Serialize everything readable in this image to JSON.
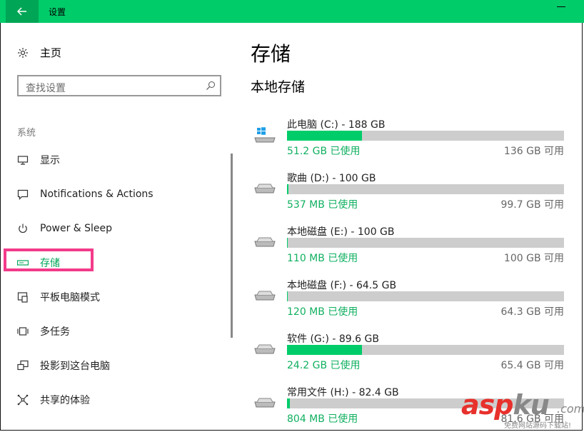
{
  "window": {
    "title": "设置",
    "back_icon": "arrow-left-icon"
  },
  "nav": {
    "home_label": "主页",
    "search_placeholder": "查找设置",
    "group_label": "系统",
    "items": [
      {
        "label": "显示",
        "icon": "monitor-icon"
      },
      {
        "label": "Notifications & Actions",
        "icon": "notification-icon"
      },
      {
        "label": "Power & Sleep",
        "icon": "power-icon"
      },
      {
        "label": "存储",
        "icon": "storage-icon",
        "active": true
      },
      {
        "label": "平板电脑模式",
        "icon": "tablet-mode-icon"
      },
      {
        "label": "多任务",
        "icon": "multitask-icon"
      },
      {
        "label": "投影到这台电脑",
        "icon": "project-icon"
      },
      {
        "label": "共享的体验",
        "icon": "shared-experience-icon"
      }
    ]
  },
  "main": {
    "title": "存储",
    "section": "本地存储",
    "drives": [
      {
        "name": "此电脑 (C:) - 188 GB",
        "used": "51.2 GB 已使用",
        "free": "136 GB 可用",
        "fill": 0.27,
        "icon": "windows-drive-icon"
      },
      {
        "name": "歌曲 (D:) - 100 GB",
        "used": "537 MB 已使用",
        "free": "99.7 GB 可用",
        "fill": 0.005,
        "icon": "hard-drive-icon"
      },
      {
        "name": "本地磁盘 (E:) - 100 GB",
        "used": "110 MB 已使用",
        "free": "100 GB 可用",
        "fill": 0.001,
        "icon": "hard-drive-icon"
      },
      {
        "name": "本地磁盘 (F:) - 64.5 GB",
        "used": "120 MB 已使用",
        "free": "64.3 GB 可用",
        "fill": 0.002,
        "icon": "hard-drive-icon"
      },
      {
        "name": "软件 (G:) - 89.6 GB",
        "used": "24.2 GB 已使用",
        "free": "65.4 GB 可用",
        "fill": 0.27,
        "icon": "hard-drive-icon"
      },
      {
        "name": "常用文件 (H:) - 82.4 GB",
        "used": "804 MB 已使用",
        "free": "81.6 GB 可用",
        "fill": 0.01,
        "icon": "hard-drive-icon"
      }
    ]
  },
  "watermark": {
    "main": "asp",
    "suffix": ".com",
    "ku": "ku",
    "sub": "免费网站源码下载站!"
  },
  "colors": {
    "accent": "#00cc6a",
    "highlight_border": "#f33a8a"
  }
}
